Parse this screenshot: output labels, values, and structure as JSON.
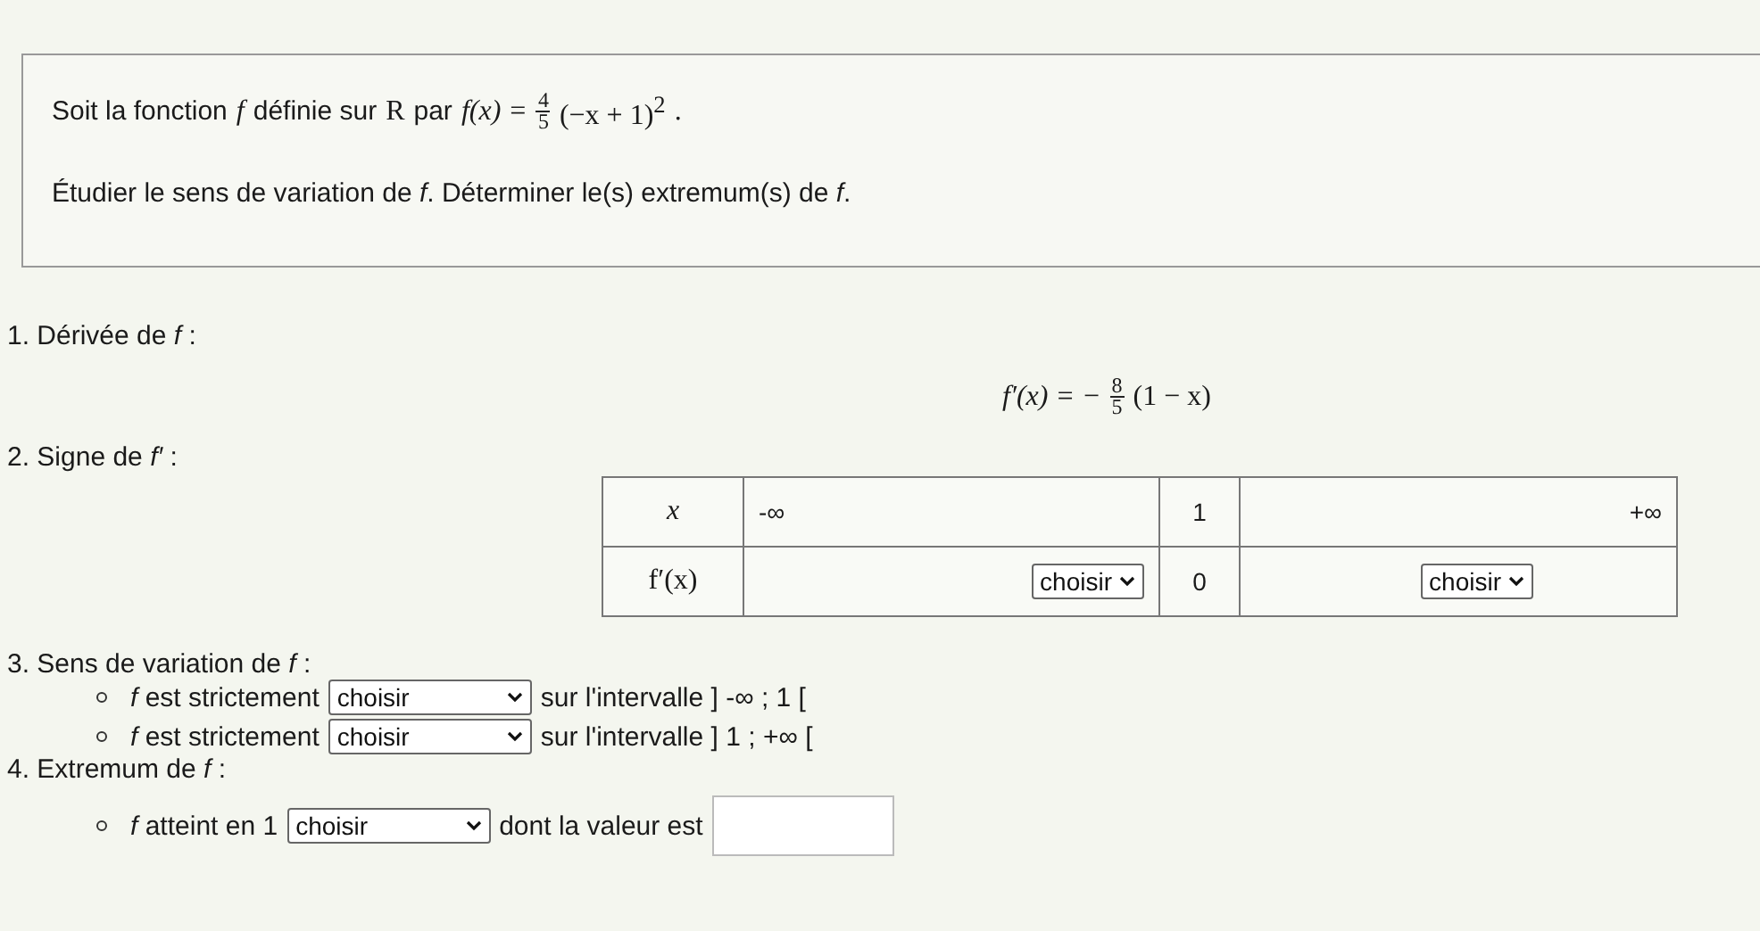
{
  "statement": {
    "intro": "Soit la fonction",
    "f": "f",
    "domain_text": "définie sur",
    "domain": "R",
    "par": "par",
    "formula": {
      "lhs": "f(x) =",
      "num": "4",
      "den": "5",
      "body": "(−x + 1)$^{2}$",
      "end": "."
    },
    "task": "Étudier le sens de variation de *f*. Déterminer le(s) extremum(s) de *f*."
  },
  "q1": {
    "title": "1. Dérivée de *f* :",
    "formula": {
      "lhs": "f′(x) = −",
      "num": "8",
      "den": "5",
      "body": "(1 − x)"
    }
  },
  "q2": {
    "title": "2. Signe de *f′* :",
    "table": {
      "row_x": {
        "label": "x",
        "minus_inf": "-∞",
        "mid": "1",
        "plus_inf": "+∞"
      },
      "row_f": {
        "label": "f′(x)",
        "left": "choisir",
        "mid": "0",
        "right": "choisir"
      }
    }
  },
  "q3": {
    "title": "3. Sens de variation de *f* :",
    "items": [
      {
        "prefix": "*f* est strictement",
        "select": "choisir",
        "suffix": "sur l'intervalle ] -∞ ; 1 ["
      },
      {
        "prefix": "*f* est strictement",
        "select": "choisir",
        "suffix": "sur l'intervalle ] 1 ; +∞ ["
      }
    ]
  },
  "q4": {
    "title": "4. Extremum de *f* :",
    "items": [
      {
        "prefix": "*f* atteint en 1",
        "select": "choisir",
        "suffix": "dont la valeur est"
      }
    ]
  }
}
